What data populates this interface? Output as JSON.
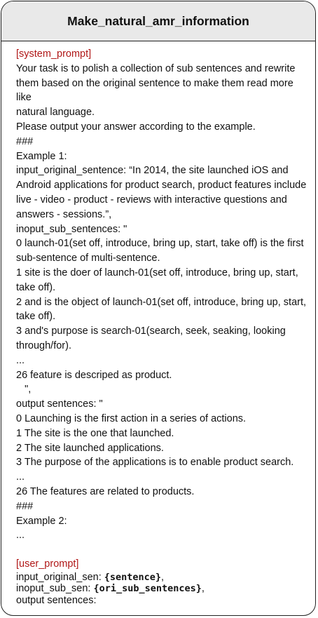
{
  "title": "Make_natural_amr_information",
  "system_tag": "[system_prompt]",
  "system_lines": [
    "Your task is to polish a collection of sub sentences and rewrite",
    "them based on the original sentence to make them read more like",
    "natural language.",
    "Please output your answer according to the example.",
    "###",
    "Example 1:",
    "input_original_sentence: “In 2014, the site launched iOS and",
    "Android applications for product search, product features include",
    "live - video - product - reviews with interactive questions and",
    "answers - sessions.”,",
    "inoput_sub_sentences: \"",
    "0 launch-01(set off, introduce, bring up, start, take off) is the first",
    "sub-sentence of multi-sentence.",
    "1 site is the doer of launch-01(set off, introduce, bring up, start,",
    "take off).",
    "2 and is the object of launch-01(set off, introduce, bring up, start,",
    "take off).",
    "3 and's purpose is search-01(search, seek, seaking, looking",
    "through/for).",
    "...",
    "26 feature is descriped as product.",
    "   \",",
    "output sentences: \"",
    "0 Launching is the first action in a series of actions.",
    "1 The site is the one that launched.",
    "2 The site launched applications.",
    "3 The purpose of the applications is to enable product search.",
    "...",
    "26 The features are related to products.",
    "###",
    "Example 2:",
    "..."
  ],
  "user_tag": "[user_prompt]",
  "user": {
    "line1_label": "input_original_sen: ",
    "line1_code": "{sentence}",
    "line1_tail": ",",
    "line2_label": "inoput_sub_sen: ",
    "line2_code": "{ori_sub_sentences}",
    "line2_tail": ",",
    "line3": "output sentences:"
  }
}
